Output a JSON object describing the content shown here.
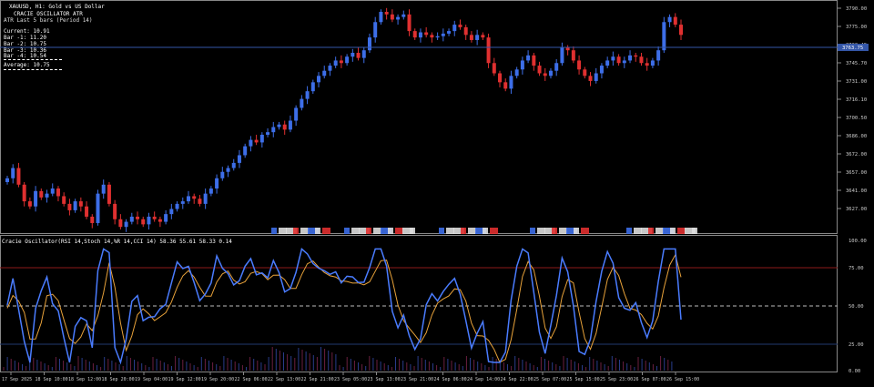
{
  "window": {
    "title": "XAUUSD, H1: Gold vs US Dollar"
  },
  "indicator_panel": {
    "name": "CRACIE OSCILLATOR ATR",
    "subtitle": "ATR Last 5 bars (Period 14)",
    "lines": [
      "Current: 10.91",
      "Bar -1: 11.20",
      "Bar -2: 10.75",
      "Bar -3: 10.36",
      "Bar -4: 10.54"
    ],
    "average": "Average: 10.75"
  },
  "oscillator_title": "Cracie Oscillator(RSI 14,Stoch 14,%R 14,CCI 14) 58.36 55.61 58.33 0.14",
  "price_axis": {
    "labels": [
      "3790.00",
      "3775.00",
      "3760.45",
      "3745.70",
      "3731.00",
      "3716.10",
      "3700.50",
      "3686.00",
      "3672.00",
      "3657.00",
      "3641.00",
      "3627.00"
    ],
    "current_price": "3763.75"
  },
  "osc_axis": {
    "labels": [
      "100.00",
      "75.00",
      "50.00",
      "25.00",
      "0.00"
    ]
  },
  "time_axis": {
    "labels": [
      "17 Sep 2025",
      "18 Sep 10:00",
      "18 Sep 12:00",
      "18 Sep 20:00",
      "19 Sep 04:00",
      "19 Sep 12:00",
      "19 Sep 20:00",
      "22 Sep 06:00",
      "22 Sep 13:00",
      "22 Sep 21:00",
      "23 Sep 05:00",
      "23 Sep 13:00",
      "23 Sep 21:00",
      "24 Sep 06:00",
      "24 Sep 14:00",
      "24 Sep 22:00",
      "25 Sep 07:00",
      "25 Sep 15:00",
      "25 Sep 23:00",
      "26 Sep 07:00",
      "26 Sep 15:00"
    ]
  },
  "colors": {
    "bull": "#3d6ee8",
    "bear": "#e03030",
    "osc_blue": "#4a7cff",
    "osc_orange": "#e8a23a",
    "level_line": "#8b1a1a",
    "price_line": "#3456a8"
  },
  "chart_data": {
    "type": "candlestick",
    "close": [
      3660,
      3668,
      3655,
      3642,
      3638,
      3650,
      3645,
      3648,
      3652,
      3646,
      3640,
      3635,
      3642,
      3638,
      3630,
      3625,
      3648,
      3655,
      3640,
      3628,
      3622,
      3626,
      3630,
      3628,
      3624,
      3630,
      3628,
      3626,
      3632,
      3636,
      3640,
      3642,
      3646,
      3644,
      3640,
      3648,
      3652,
      3660,
      3665,
      3668,
      3672,
      3678,
      3685,
      3690,
      3688,
      3694,
      3696,
      3700,
      3702,
      3698,
      3705,
      3715,
      3722,
      3728,
      3735,
      3740,
      3744,
      3748,
      3752,
      3750,
      3755,
      3758,
      3754,
      3760,
      3770,
      3782,
      3790,
      3788,
      3784,
      3786,
      3788,
      3775,
      3770,
      3774,
      3772,
      3770,
      3771,
      3773,
      3775,
      3780,
      3778,
      3772,
      3768,
      3772,
      3770,
      3750,
      3742,
      3735,
      3730,
      3740,
      3745,
      3752,
      3756,
      3748,
      3742,
      3740,
      3744,
      3750,
      3762,
      3760,
      3752,
      3745,
      3740,
      3736,
      3742,
      3748,
      3752,
      3755,
      3750,
      3752,
      3756,
      3755,
      3750,
      3748,
      3752,
      3760,
      3782,
      3786,
      3780,
      3772
    ]
  }
}
